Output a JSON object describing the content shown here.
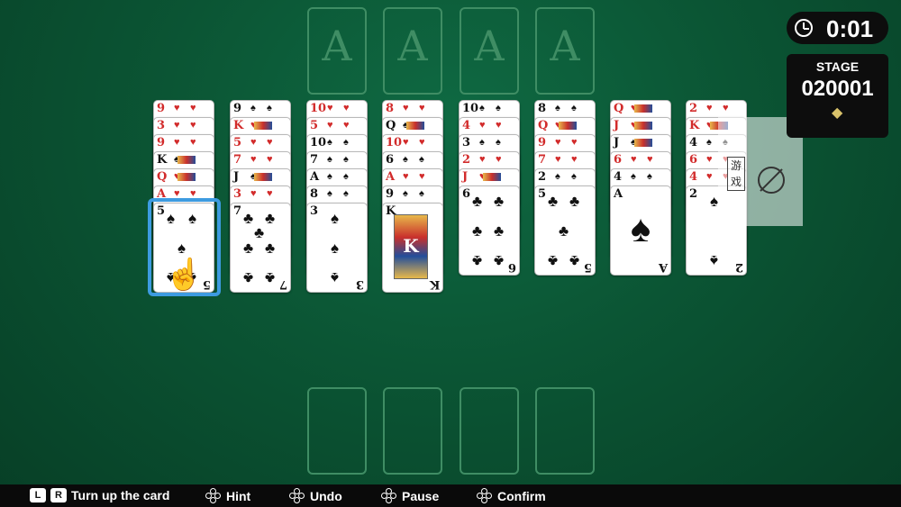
{
  "foundations": [
    {
      "label": "A",
      "icon": "ace-placeholder"
    },
    {
      "label": "A",
      "icon": "ace-placeholder"
    },
    {
      "label": "A",
      "icon": "ace-placeholder"
    },
    {
      "label": "A",
      "icon": "ace-placeholder"
    }
  ],
  "free_cells": [
    {
      "icon": "empty-cell"
    },
    {
      "icon": "empty-cell"
    },
    {
      "icon": "empty-cell"
    },
    {
      "icon": "empty-cell"
    }
  ],
  "tableau": [
    {
      "covered": [
        {
          "rank": "9",
          "color": "red"
        },
        {
          "rank": "3",
          "color": "red"
        },
        {
          "rank": "9",
          "color": "red"
        },
        {
          "rank": "K",
          "color": "blk"
        },
        {
          "rank": "Q",
          "color": "red"
        },
        {
          "rank": "A",
          "color": "red"
        }
      ],
      "top": {
        "rank": "5",
        "suit": "♠",
        "color": "blk"
      }
    },
    {
      "covered": [
        {
          "rank": "9",
          "color": "blk"
        },
        {
          "rank": "K",
          "color": "red"
        },
        {
          "rank": "5",
          "color": "red"
        },
        {
          "rank": "7",
          "color": "red"
        },
        {
          "rank": "J",
          "color": "blk"
        },
        {
          "rank": "3",
          "color": "red"
        }
      ],
      "top": {
        "rank": "7",
        "suit": "♣",
        "color": "blk"
      }
    },
    {
      "covered": [
        {
          "rank": "10",
          "color": "red"
        },
        {
          "rank": "5",
          "color": "red"
        },
        {
          "rank": "10",
          "color": "blk"
        },
        {
          "rank": "7",
          "color": "blk"
        },
        {
          "rank": "A",
          "color": "blk"
        },
        {
          "rank": "8",
          "color": "blk"
        }
      ],
      "top": {
        "rank": "3",
        "suit": "♠",
        "color": "blk"
      }
    },
    {
      "covered": [
        {
          "rank": "8",
          "color": "red"
        },
        {
          "rank": "Q",
          "color": "blk"
        },
        {
          "rank": "10",
          "color": "red"
        },
        {
          "rank": "6",
          "color": "blk"
        },
        {
          "rank": "A",
          "color": "red"
        },
        {
          "rank": "9",
          "color": "blk"
        }
      ],
      "top": {
        "rank": "K",
        "suit": "♠",
        "color": "blk"
      }
    },
    {
      "covered": [
        {
          "rank": "10",
          "color": "blk"
        },
        {
          "rank": "4",
          "color": "red"
        },
        {
          "rank": "3",
          "color": "blk"
        },
        {
          "rank": "2",
          "color": "red"
        },
        {
          "rank": "J",
          "color": "red"
        }
      ],
      "top": {
        "rank": "6",
        "suit": "♣",
        "color": "blk"
      }
    },
    {
      "covered": [
        {
          "rank": "8",
          "color": "blk"
        },
        {
          "rank": "Q",
          "color": "red"
        },
        {
          "rank": "9",
          "color": "red"
        },
        {
          "rank": "7",
          "color": "red"
        },
        {
          "rank": "2",
          "color": "blk"
        }
      ],
      "top": {
        "rank": "5",
        "suit": "♣",
        "color": "blk"
      }
    },
    {
      "covered": [
        {
          "rank": "Q",
          "color": "red"
        },
        {
          "rank": "J",
          "color": "red"
        },
        {
          "rank": "J",
          "color": "blk"
        },
        {
          "rank": "6",
          "color": "red"
        },
        {
          "rank": "4",
          "color": "blk"
        }
      ],
      "top": {
        "rank": "A",
        "suit": "♠",
        "color": "blk"
      }
    },
    {
      "covered": [
        {
          "rank": "2",
          "color": "red"
        },
        {
          "rank": "K",
          "color": "red"
        },
        {
          "rank": "4",
          "color": "blk"
        },
        {
          "rank": "6",
          "color": "red"
        },
        {
          "rank": "4",
          "color": "red"
        }
      ],
      "top": {
        "rank": "2",
        "suit": "♠",
        "color": "blk"
      }
    }
  ],
  "timer": {
    "value": "0:01",
    "icon": "clock-icon"
  },
  "stage": {
    "label": "STAGE",
    "number": "020001",
    "icon": "diamond-icon"
  },
  "watermark": {
    "text": "游戏"
  },
  "controls": [
    {
      "keys": [
        "L",
        "R"
      ],
      "label": "Turn up the card"
    },
    {
      "label": "Hint",
      "icon": "dpad-icon"
    },
    {
      "label": "Undo",
      "icon": "dpad-icon"
    },
    {
      "label": "Pause",
      "icon": "dpad-icon"
    },
    {
      "label": "Confirm",
      "icon": "dpad-icon"
    }
  ],
  "colors": {
    "felt": "#0b5534",
    "slot_outline": "#3f8d64",
    "selection": "#3d9be0",
    "red_suit": "#d22b2b"
  }
}
